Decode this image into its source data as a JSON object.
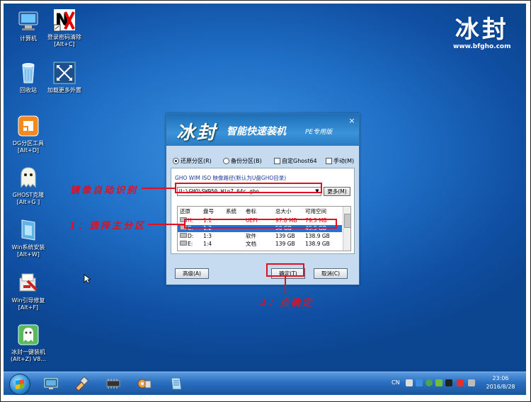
{
  "desktop": {
    "icons": [
      {
        "label": "计算机"
      },
      {
        "label": "登录密码清除\n[Alt+C]"
      },
      {
        "label": "回收站"
      },
      {
        "label": "加载更多外置"
      },
      {
        "label": "DG分区工具\n[Alt+D]"
      },
      {
        "label": "GHOST克隆\n[Alt+G ]"
      },
      {
        "label": "Win系统安装\n[Alt+W]"
      },
      {
        "label": "Win引导修复\n[Alt+F]"
      },
      {
        "label": "冰封一键装机\n(Alt+Z) V8..."
      }
    ],
    "brand": {
      "name": "冰封",
      "url": "www.bfgho.com"
    }
  },
  "dialog": {
    "title_brand": "冰封",
    "title_main": "智能快速装机",
    "title_edition": "PE专用版",
    "close_glyph": "×",
    "options": [
      {
        "label": "还原分区(R)",
        "type": "radio",
        "checked": true
      },
      {
        "label": "备份分区(B)",
        "type": "radio",
        "checked": false
      },
      {
        "label": "自定Ghost64",
        "type": "checkbox",
        "checked": false
      },
      {
        "label": "手动(M)",
        "type": "checkbox",
        "checked": false
      }
    ],
    "path_label": "GHO WIM ISO 映像路径(默认为U盘GHO目录)",
    "path_value": "U:\\GHO\\SW950 Win7 64c.gho",
    "more_button": "更多(M)",
    "table": {
      "headers": [
        "还原",
        "盘号",
        "系统",
        "卷标",
        "总大小",
        "可用空间"
      ],
      "rows": [
        {
          "restore": "H:",
          "disk": "1:1",
          "system": "",
          "label": "UEFI",
          "total": "97.8 MB",
          "free": "79.3 MB"
        },
        {
          "restore": "C:",
          "disk": "1:2",
          "system": "",
          "label": "",
          "total": "50 GB",
          "free": "49.9 GB"
        },
        {
          "restore": "D:",
          "disk": "1:3",
          "system": "",
          "label": "软件",
          "total": "139 GB",
          "free": "138.9 GB"
        },
        {
          "restore": "E:",
          "disk": "1:4",
          "system": "",
          "label": "文档",
          "total": "139 GB",
          "free": "138.9 GB"
        }
      ]
    },
    "advanced_button": "高级(A)",
    "ok_button": "确定(T)",
    "cancel_button": "取消(C)"
  },
  "annotations": {
    "path": "镜像自动识别",
    "partition": "1：选择主分区",
    "confirm": "2：点确定"
  },
  "colors": {
    "annotation": "#e01020",
    "selected_row": "#1f74d6"
  },
  "taskbar": {
    "lang": "CN",
    "time": "23:06",
    "date": "2016/8/28"
  }
}
